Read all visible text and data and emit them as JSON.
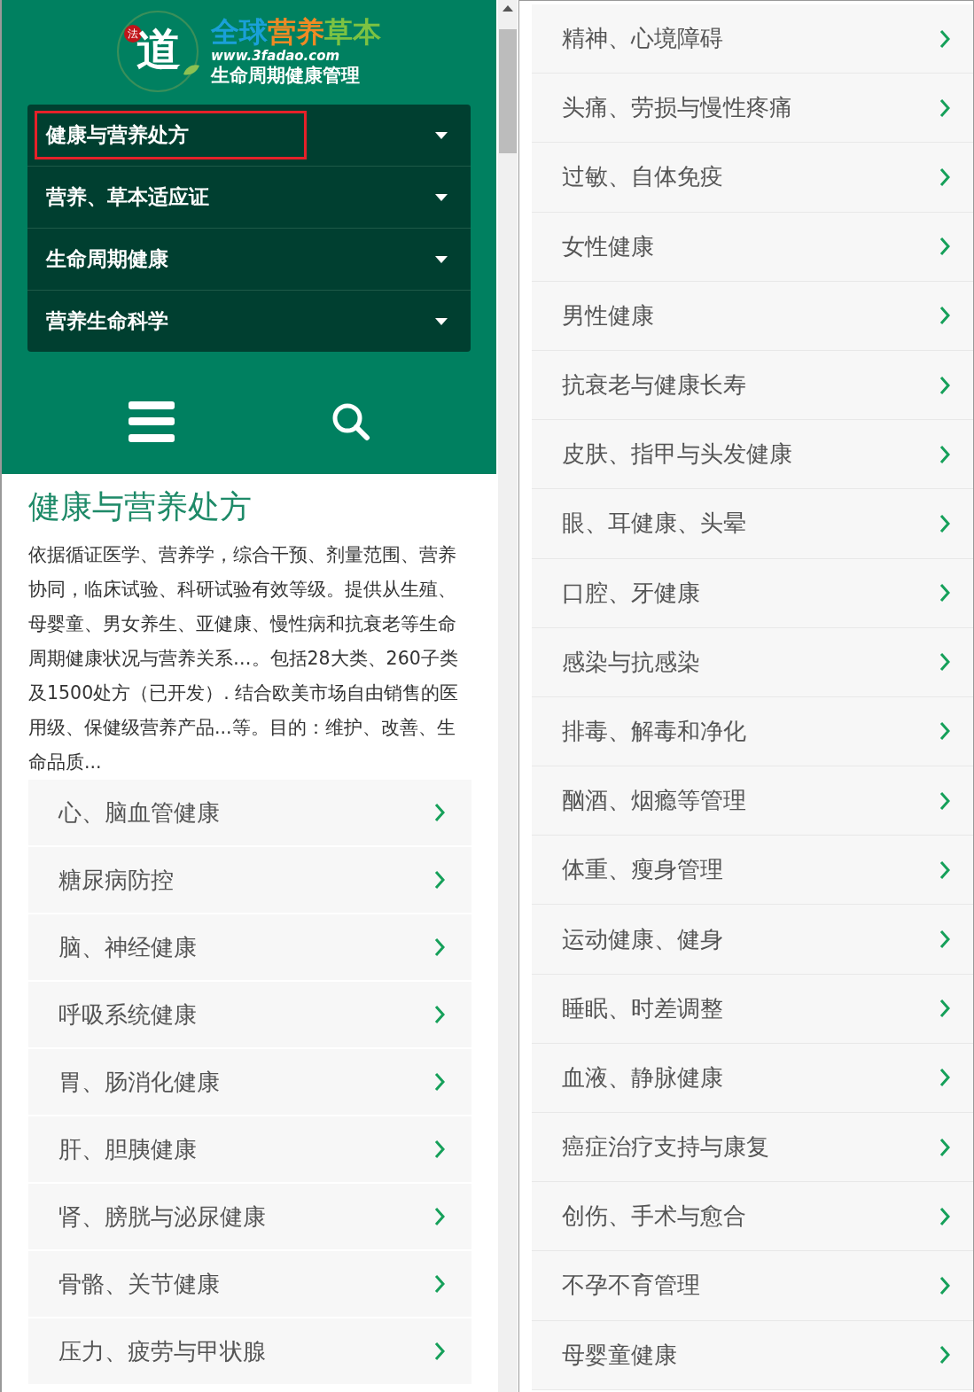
{
  "logo": {
    "seal": "法",
    "mark": "道",
    "title_parts": [
      {
        "text": "全球",
        "color": "#1aa0d8"
      },
      {
        "text": "营养",
        "color": "#f08a24"
      },
      {
        "text": "草本",
        "color": "#7cc242"
      }
    ],
    "url": "www.3fadao.com",
    "tagline": "生命周期健康管理"
  },
  "nav_menu": [
    {
      "label": "健康与营养处方",
      "highlighted": true
    },
    {
      "label": "营养、草本适应证",
      "highlighted": false
    },
    {
      "label": "生命周期健康",
      "highlighted": false
    },
    {
      "label": "营养生命科学",
      "highlighted": false
    }
  ],
  "section": {
    "title": "健康与营养处方",
    "description": "依据循证医学、营养学，综合干预、剂量范围、营养协同，临床试验、科研试验有效等级。提供从生殖、母婴童、男女养生、亚健康、慢性病和抗衰老等生命周期健康状况与营养关系…。包括28大类、260子类及1500处方（已开发）. 结合欧美市场自由销售的医用级、保健级营养产品...等。目的：维护、改善、生命品质..."
  },
  "categories_left": [
    "心、脑血管健康",
    "糖尿病防控",
    "脑、神经健康",
    "呼吸系统健康",
    "胃、肠消化健康",
    "肝、胆胰健康",
    "肾、膀胱与泌尿健康",
    "骨骼、关节健康",
    "压力、疲劳与甲状腺"
  ],
  "categories_right": [
    "精神、心境障碍",
    "头痛、劳损与慢性疼痛",
    "过敏、自体免疫",
    "女性健康",
    "男性健康",
    "抗衰老与健康长寿",
    "皮肤、指甲与头发健康",
    "眼、耳健康、头晕",
    "口腔、牙健康",
    "感染与抗感染",
    "排毒、解毒和净化",
    "酗酒、烟瘾等管理",
    "体重、瘦身管理",
    "运动健康、健身",
    "睡眠、时差调整",
    "血液、静脉健康",
    "癌症治疗支持与康复",
    "创伤、手术与愈合",
    "不孕不育管理",
    "母婴童健康"
  ]
}
